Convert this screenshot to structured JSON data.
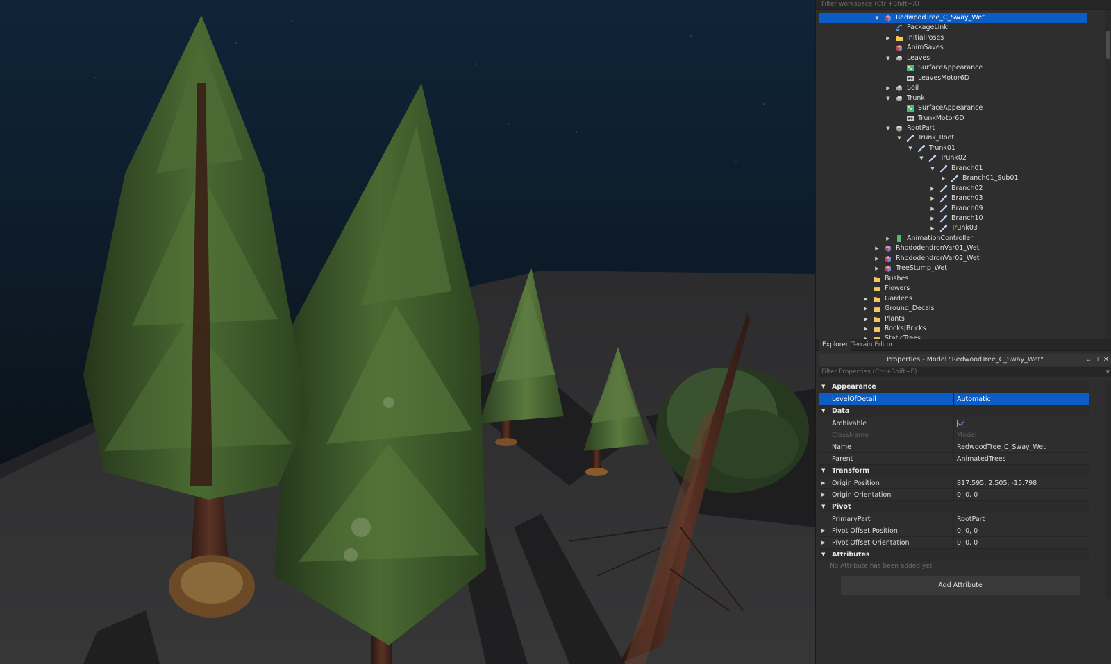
{
  "explorer": {
    "filter_placeholder": "Filter workspace (Ctrl+Shift+X)",
    "items": [
      {
        "label": "RedwoodTree_C_Sway_Wet",
        "icon": "model-icon",
        "arrow": "expanded",
        "depth": 3,
        "selected": true
      },
      {
        "label": "PackageLink",
        "icon": "package-link-icon",
        "arrow": "none",
        "depth": 4
      },
      {
        "label": "InitialPoses",
        "icon": "folder-icon",
        "arrow": "collapsed",
        "depth": 4
      },
      {
        "label": "AnimSaves",
        "icon": "model-icon",
        "arrow": "none",
        "depth": 4
      },
      {
        "label": "Leaves",
        "icon": "meshpart-icon",
        "arrow": "expanded",
        "depth": 4
      },
      {
        "label": "SurfaceAppearance",
        "icon": "surface-appearance-icon",
        "arrow": "none",
        "depth": 5
      },
      {
        "label": "LeavesMotor6D",
        "icon": "motor6d-icon",
        "arrow": "none",
        "depth": 5
      },
      {
        "label": "Soil",
        "icon": "meshpart-icon",
        "arrow": "collapsed",
        "depth": 4
      },
      {
        "label": "Trunk",
        "icon": "meshpart-icon",
        "arrow": "expanded",
        "depth": 4
      },
      {
        "label": "SurfaceAppearance",
        "icon": "surface-appearance-icon",
        "arrow": "none",
        "depth": 5
      },
      {
        "label": "TrunkMotor6D",
        "icon": "motor6d-icon",
        "arrow": "none",
        "depth": 5
      },
      {
        "label": "RootPart",
        "icon": "part-icon",
        "arrow": "expanded",
        "depth": 4
      },
      {
        "label": "Trunk_Root",
        "icon": "bone-icon",
        "arrow": "expanded",
        "depth": 5
      },
      {
        "label": "Trunk01",
        "icon": "bone-icon",
        "arrow": "expanded",
        "depth": 6
      },
      {
        "label": "Trunk02",
        "icon": "bone-icon",
        "arrow": "expanded",
        "depth": 7
      },
      {
        "label": "Branch01",
        "icon": "bone-icon",
        "arrow": "expanded",
        "depth": 8
      },
      {
        "label": "Branch01_Sub01",
        "icon": "bone-icon",
        "arrow": "collapsed",
        "depth": 9
      },
      {
        "label": "Branch02",
        "icon": "bone-icon",
        "arrow": "collapsed",
        "depth": 8
      },
      {
        "label": "Branch03",
        "icon": "bone-icon",
        "arrow": "collapsed",
        "depth": 8
      },
      {
        "label": "Branch09",
        "icon": "bone-icon",
        "arrow": "collapsed",
        "depth": 8
      },
      {
        "label": "Branch10",
        "icon": "bone-icon",
        "arrow": "collapsed",
        "depth": 8
      },
      {
        "label": "Trunk03",
        "icon": "bone-icon",
        "arrow": "collapsed",
        "depth": 8
      },
      {
        "label": "AnimationController",
        "icon": "animation-controller-icon",
        "arrow": "collapsed",
        "depth": 4
      },
      {
        "label": "RhododendronVar01_Wet",
        "icon": "model-icon",
        "arrow": "collapsed",
        "depth": 3
      },
      {
        "label": "RhododendronVar02_Wet",
        "icon": "model-icon",
        "arrow": "collapsed",
        "depth": 3
      },
      {
        "label": "TreeStump_Wet",
        "icon": "model-icon",
        "arrow": "collapsed",
        "depth": 3
      },
      {
        "label": "Bushes",
        "icon": "folder-icon",
        "arrow": "none",
        "depth": 2
      },
      {
        "label": "Flowers",
        "icon": "folder-icon",
        "arrow": "none",
        "depth": 2
      },
      {
        "label": "Gardens",
        "icon": "folder-icon",
        "arrow": "collapsed",
        "depth": 2
      },
      {
        "label": "Ground_Decals",
        "icon": "folder-icon",
        "arrow": "collapsed",
        "depth": 2
      },
      {
        "label": "Plants",
        "icon": "folder-icon",
        "arrow": "collapsed",
        "depth": 2
      },
      {
        "label": "Rocks|Bricks",
        "icon": "folder-icon",
        "arrow": "collapsed",
        "depth": 2
      },
      {
        "label": "StaticTrees",
        "icon": "folder-icon",
        "arrow": "collapsed",
        "depth": 2
      }
    ]
  },
  "tabs": [
    {
      "label": "Explorer",
      "active": true
    },
    {
      "label": "Terrain Editor",
      "active": false
    }
  ],
  "properties": {
    "title": "Properties - Model \"RedwoodTree_C_Sway_Wet\"",
    "filter_placeholder": "Filter Properties (Ctrl+Shift+P)",
    "rows": [
      {
        "kind": "category",
        "label": "Appearance"
      },
      {
        "kind": "prop",
        "name": "LevelOfDetail",
        "value": "Automatic",
        "selected": true
      },
      {
        "kind": "category",
        "label": "Data"
      },
      {
        "kind": "prop",
        "name": "Archivable",
        "checkbox": true,
        "checked": true
      },
      {
        "kind": "prop",
        "name": "ClassName",
        "value": "Model",
        "disabled": true
      },
      {
        "kind": "prop",
        "name": "Name",
        "value": "RedwoodTree_C_Sway_Wet"
      },
      {
        "kind": "prop",
        "name": "Parent",
        "value": "AnimatedTrees"
      },
      {
        "kind": "category",
        "label": "Transform"
      },
      {
        "kind": "prop",
        "name": "Origin Position",
        "value": "817.595, 2.505, -15.798",
        "expandable": true
      },
      {
        "kind": "prop",
        "name": "Origin Orientation",
        "value": "0, 0, 0",
        "expandable": true
      },
      {
        "kind": "category",
        "label": "Pivot"
      },
      {
        "kind": "prop",
        "name": "PrimaryPart",
        "value": "RootPart"
      },
      {
        "kind": "prop",
        "name": "Pivot Offset Position",
        "value": "0, 0, 0",
        "expandable": true
      },
      {
        "kind": "prop",
        "name": "Pivot Offset Orientation",
        "value": "0, 0, 0",
        "expandable": true
      },
      {
        "kind": "category",
        "label": "Attributes"
      },
      {
        "kind": "note",
        "label": "No Attribute has been added yet"
      }
    ],
    "add_attribute_label": "Add Attribute"
  },
  "colors": {
    "selection": "#0b5cc4",
    "panel_bg": "#2e2e2e",
    "sky_top": "#0f2438",
    "ground": "#323233"
  }
}
